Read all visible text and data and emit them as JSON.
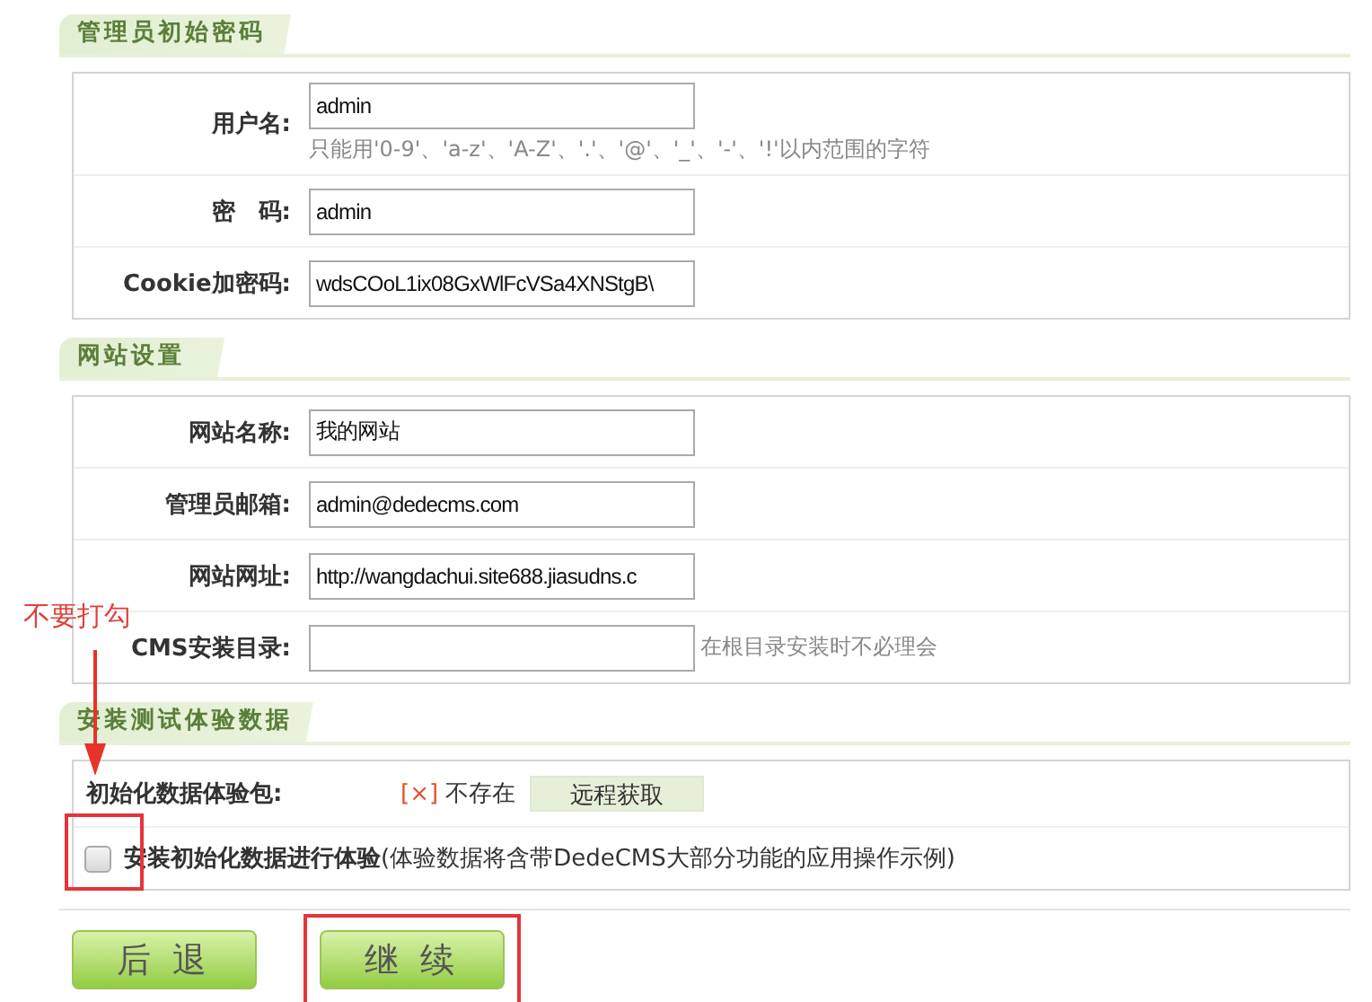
{
  "sections": [
    {
      "title": "管理员初始密码",
      "rows": [
        {
          "kind": "field",
          "label": "用户名:",
          "value": "admin",
          "hint": "只能用'0-9'、'a-z'、'A-Z'、'.'、'@'、'_'、'-'、'!'以内范围的字符"
        },
        {
          "kind": "field",
          "label": "密　码:",
          "value": "admin"
        },
        {
          "kind": "field",
          "label": "Cookie加密码:",
          "value": "wdsCOoL1ix08GxWlFcVSa4XNStgB\\"
        }
      ]
    },
    {
      "title": "网站设置",
      "rows": [
        {
          "kind": "field",
          "label": "网站名称:",
          "value": "我的网站"
        },
        {
          "kind": "field",
          "label": "管理员邮箱:",
          "value": "admin@dedecms.com"
        },
        {
          "kind": "field",
          "label": "网站网址:",
          "value": "http://wangdachui.site688.jiasudns.c"
        },
        {
          "kind": "field",
          "label": "CMS安装目录:",
          "note": "在根目录安装时不必理会"
        }
      ]
    },
    {
      "title": "安装测试体验数据",
      "rows": [
        {
          "kind": "package",
          "label": "初始化数据体验包:",
          "mark": "[×]",
          "status": "不存在",
          "button": "远程获取"
        },
        {
          "kind": "checkbox",
          "checked": false,
          "highlighted": true,
          "text": "**安装初始化数据进行体验**(体验数据将含带DedeCMS大部分功能的应用操作示例)"
        }
      ]
    }
  ],
  "buttons": [
    {
      "label": "后 退",
      "highlighted": false
    },
    {
      "label": "继 续",
      "highlighted": true
    }
  ],
  "annotation": {
    "text": "不要打勾"
  }
}
